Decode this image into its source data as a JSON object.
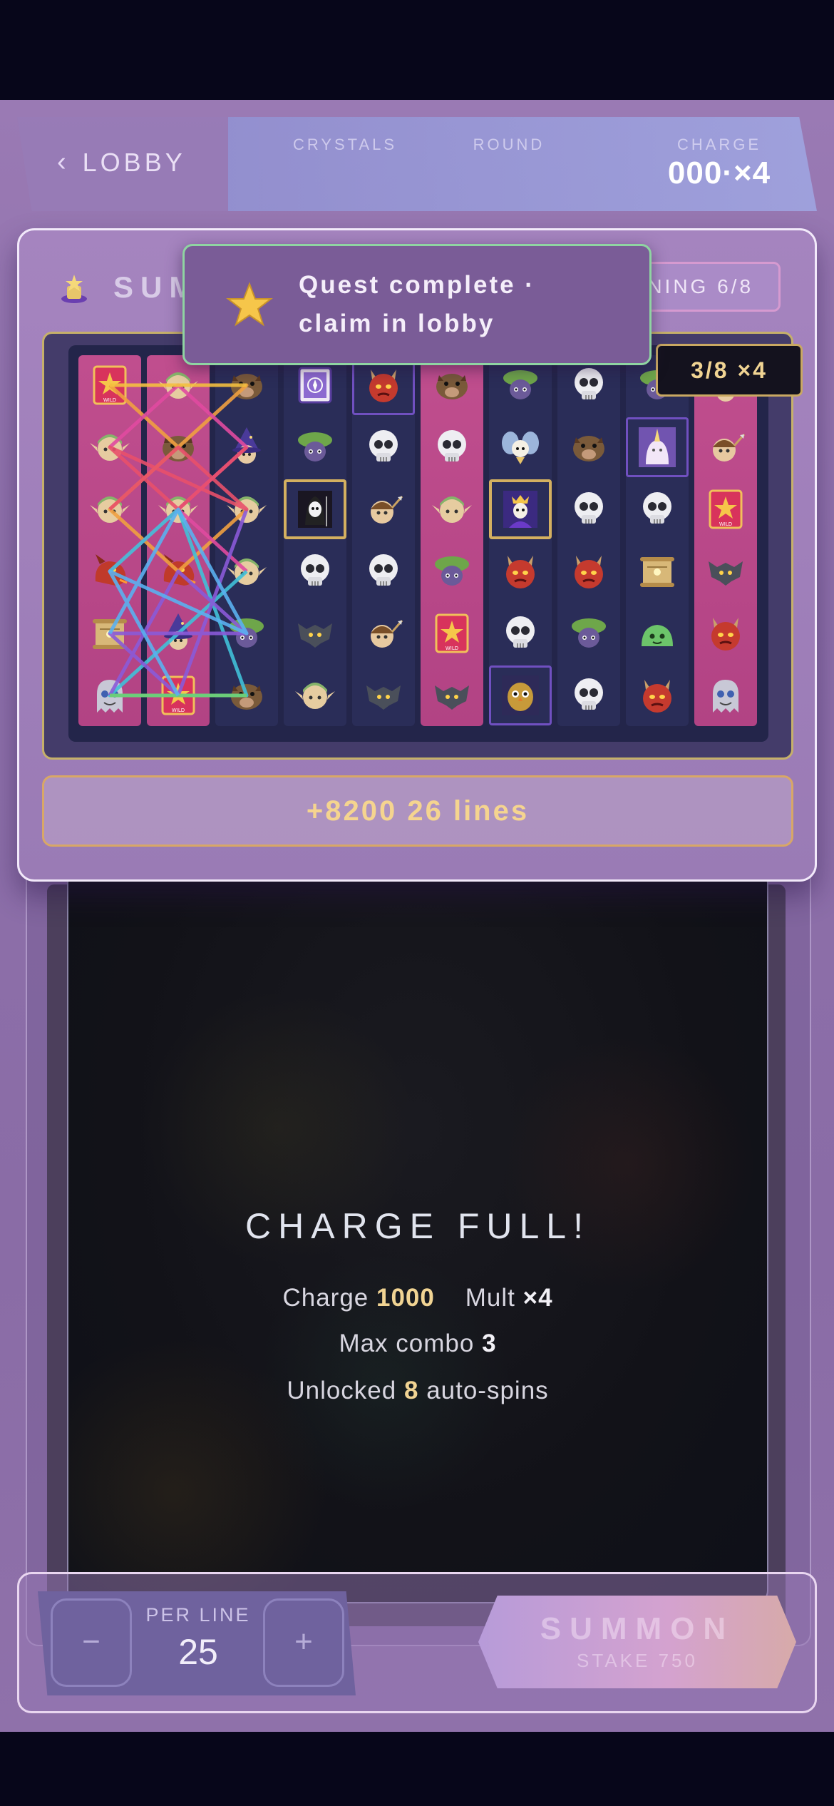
{
  "hud": {
    "lobby_label": "LOBBY",
    "stats": [
      {
        "label": "CRYSTALS",
        "value": ""
      },
      {
        "label": "ROUND",
        "value": ""
      },
      {
        "label": "CHARGE",
        "value": "000·×4"
      }
    ]
  },
  "toast": {
    "message": "Quest complete · claim in lobby"
  },
  "altar": {
    "title": "SUMMONING ALTAR",
    "spin_badge": "SPINNING 6/8",
    "ways_badge": "3/8 ×4",
    "win_text": "+8200 26 lines"
  },
  "reels": [
    {
      "highlight": true,
      "symbols": [
        "wild",
        "elf",
        "elf",
        "dragon",
        "scroll",
        "ghost"
      ]
    },
    {
      "highlight": true,
      "symbols": [
        "elf",
        "boar",
        "elf",
        "dragon",
        "wizard",
        "wild"
      ]
    },
    {
      "highlight": false,
      "symbols": [
        "boar",
        "wizard",
        "elf",
        "elf",
        "goblin",
        "boar"
      ]
    },
    {
      "highlight": false,
      "symbols": [
        "spellbook",
        "goblin",
        "reaper",
        "skull",
        "bat",
        "elf"
      ]
    },
    {
      "highlight": false,
      "symbols": [
        "demon",
        "skull",
        "hunter",
        "skull",
        "hunter",
        "bat"
      ]
    },
    {
      "highlight": true,
      "symbols": [
        "boar",
        "skull",
        "elf",
        "goblin",
        "wild",
        "bat"
      ]
    },
    {
      "highlight": false,
      "symbols": [
        "goblin",
        "fairy",
        "king",
        "demon",
        "skull",
        "owl"
      ]
    },
    {
      "highlight": false,
      "symbols": [
        "skull",
        "boar",
        "skull",
        "demon",
        "goblin",
        "skull"
      ]
    },
    {
      "highlight": false,
      "symbols": [
        "goblin",
        "unicorn",
        "skull",
        "scroll",
        "slime",
        "demon"
      ]
    },
    {
      "highlight": true,
      "symbols": [
        "wizard",
        "hunter",
        "wild",
        "bat",
        "demon",
        "ghost"
      ]
    }
  ],
  "result": {
    "title": "CHARGE FULL!",
    "charge_label": "Charge",
    "charge_value": "1000",
    "mult_label": "Mult",
    "mult_value": "×4",
    "combo_label": "Max combo",
    "combo_value": "3",
    "unlock_label": "Unlocked",
    "unlock_value": "8",
    "unlock_suffix": "auto-spins"
  },
  "controls": {
    "minus": "−",
    "plus": "+",
    "per_line_label": "PER LINE",
    "per_line_value": "25",
    "summon_label": "SUMMON",
    "stake_label": "STAKE 750"
  },
  "colors": {
    "accent_gold": "#f1d493",
    "reel_highlight": "#c04e8e",
    "toast_border": "#8fd4a2"
  }
}
